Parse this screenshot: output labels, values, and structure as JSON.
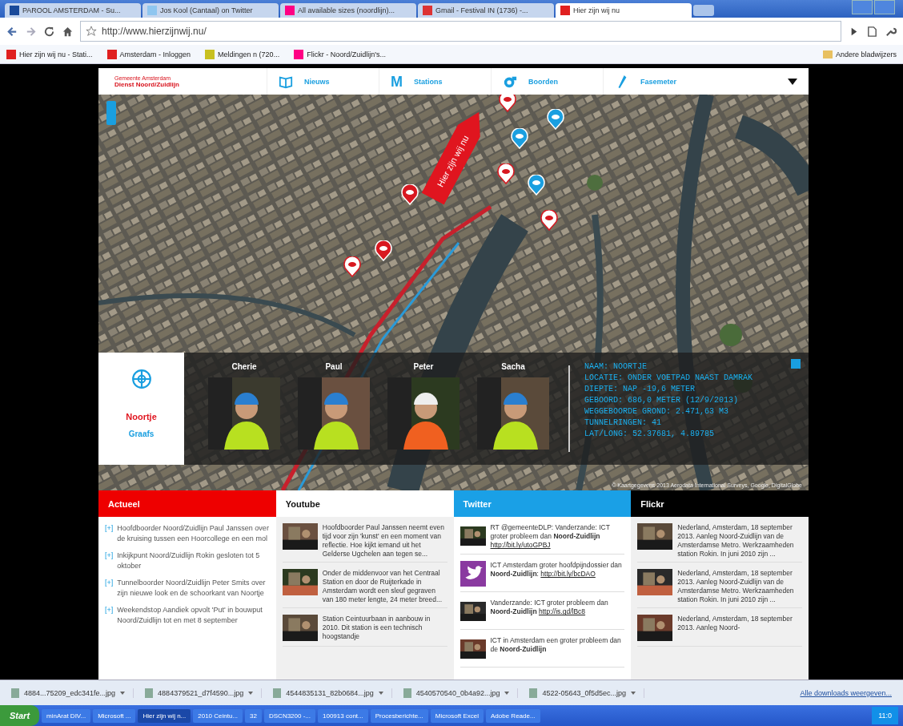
{
  "browser": {
    "tabs": [
      {
        "title": "PAROOL AMSTERDAM - Su...",
        "selected": false
      },
      {
        "title": "Jos Kool (Cantaal) on Twitter",
        "selected": false
      },
      {
        "title": "All available sizes (noordlijn)...",
        "selected": false
      },
      {
        "title": "Gmail - Festival IN (1736) -...",
        "selected": false
      },
      {
        "title": "Hier zijn wij nu",
        "selected": true
      }
    ],
    "url": "http://www.hierzijnwij.nu/",
    "bookmarks": [
      "Hier zijn wij nu - Stati...",
      "Amsterdam - Inloggen",
      "Meldingen n (720...",
      "Flickr - Noord/Zuidlijn's..."
    ],
    "other_bookmarks": "Andere bladwijzers"
  },
  "site": {
    "logo": {
      "line1": "Gemeente Amsterdam",
      "line2": "Dienst Noord/Zuidlijn"
    },
    "nav": [
      {
        "label": "Nieuws",
        "kind": "news"
      },
      {
        "label": "Stations",
        "kind": "stations",
        "mark": "M"
      },
      {
        "label": "Boorden",
        "kind": "drills"
      },
      {
        "label": "Fasemeter",
        "kind": "meter"
      }
    ],
    "map_banner": "Hier zijn wij nu",
    "info": {
      "machine": {
        "name": "Noortje",
        "surname": "Graafs"
      },
      "crew": [
        {
          "name": "Cherie"
        },
        {
          "name": "Paul"
        },
        {
          "name": "Peter"
        },
        {
          "name": "Sacha"
        }
      ],
      "stats": [
        "NAAM: NOORTJE",
        "LOCATIE: ONDER VOETPAD NAAST DAMRAK",
        "DIEPTE: NAP -19,6 METER",
        "GEBOORD: 686,0 METER (12/9/2013)",
        "WEGGEBOORDE GROND: 2.471,63 M3",
        "TUNNELRINGEN: 41",
        "LAT/LONG: 52.37681, 4.89785"
      ]
    },
    "map_credit": "© Kaartgegevens 2013 Aerodata International Surveys, Google, DigitalGlobe",
    "columns": [
      {
        "title": "Actueel",
        "kind": "news",
        "color": "#ee0000",
        "expand_label": "[+]",
        "items": [
          {
            "text": "Hoofdboorder Noord/Zuidlijn Paul Janssen over de kruising tussen een Hoorcollege en een mol"
          },
          {
            "text": "Inkijkpunt Noord/Zuidlijn Rokin gesloten tot 5 oktober"
          },
          {
            "text": "Tunnelboorder Noord/Zuidlijn Peter Smits over zijn nieuwe look en de schoorkant van Noortje"
          },
          {
            "text": "Weekendstop Aandiek opvolt 'Put' in bouwput Noord/Zuidlijn tot en met 8 september"
          }
        ]
      },
      {
        "title": "Youtube",
        "kind": "video",
        "color": "#ffffff",
        "items": [
          {
            "text": "Hoofdboorder Paul Janssen neemt even tijd voor zijn 'kunst' en een moment van reflectie. Hoe kijkt iemand uit het Gelderse Ugchelen aan tegen se..."
          },
          {
            "text": "Onder de middenvoor van het Centraal Station en door de Ruijterkade in Amsterdam wordt een sleuf gegraven van 180 meter lengte, 24 meter breed..."
          },
          {
            "text": "Station Ceintuurbaan in aanbouw in 2010. Dit station is een technisch hoogstandje"
          }
        ]
      },
      {
        "title": "Twitter",
        "kind": "twitter",
        "color": "#1aa0e6",
        "items": [
          {
            "text": "RT @gemeenteDLP: Vanderzande: ICT groter probleem dan **Noord-Zuidlijn**",
            "link": "http://bit.ly/utoGPBJ"
          },
          {
            "text": "ICT Amsterdam groter hoofdpijndossier dan **Noord-Zuidlijn**:",
            "link": "http://bit.ly/bcDAO"
          },
          {
            "text": "Vanderzande: ICT groter probleem dan **Noord-Zuidlijn**",
            "link": "http://is.gd/lBc8"
          },
          {
            "text": "ICT in Amsterdam een groter probleem dan de **Noord-Zuidlijn**"
          }
        ]
      },
      {
        "title": "Flickr",
        "kind": "flickr",
        "color": "#000000",
        "items": [
          {
            "text": "Nederland, Amsterdam, 18 september 2013. Aanleg Noord-Zuidlijn van de Amsterdamse Metro. Werkzaamheden station Rokin. In juni 2010 zijn ..."
          },
          {
            "text": "Nederland, Amsterdam, 18 september 2013. Aanleg Noord-Zuidlijn van de Amsterdamse Metro. Werkzaamheden station Rokin. In juni 2010 zijn ..."
          },
          {
            "text": "Nederland, Amsterdam, 18 september 2013. Aanleg Noord-"
          }
        ]
      }
    ]
  },
  "downloads": {
    "files": [
      "4884...75209_edc341fe...jpg",
      "4884379521_d7f4590...jpg",
      "4544835131_82b0684...jpg",
      "4540570540_0b4a92...jpg",
      "4522-05643_0f5d5ec...jpg"
    ],
    "show_all": "Alle downloads weergeven..."
  },
  "taskbar": {
    "start": "Start",
    "items": [
      {
        "label": "minArat DIV...",
        "selected": false
      },
      {
        "label": "Microsoft ...",
        "selected": false
      },
      {
        "label": "Hier zijn wij n...",
        "selected": true
      },
      {
        "label": "2010 Ceintu...",
        "selected": false
      },
      {
        "label": "32",
        "selected": false
      },
      {
        "label": "DSCN3200 -...",
        "selected": false
      },
      {
        "label": "100913 cont...",
        "selected": false
      },
      {
        "label": "Procesberichte...",
        "selected": false
      },
      {
        "label": "Microsoft Excel",
        "selected": false
      },
      {
        "label": "Adobe Reade...",
        "selected": false
      }
    ],
    "clock": "11:0"
  }
}
